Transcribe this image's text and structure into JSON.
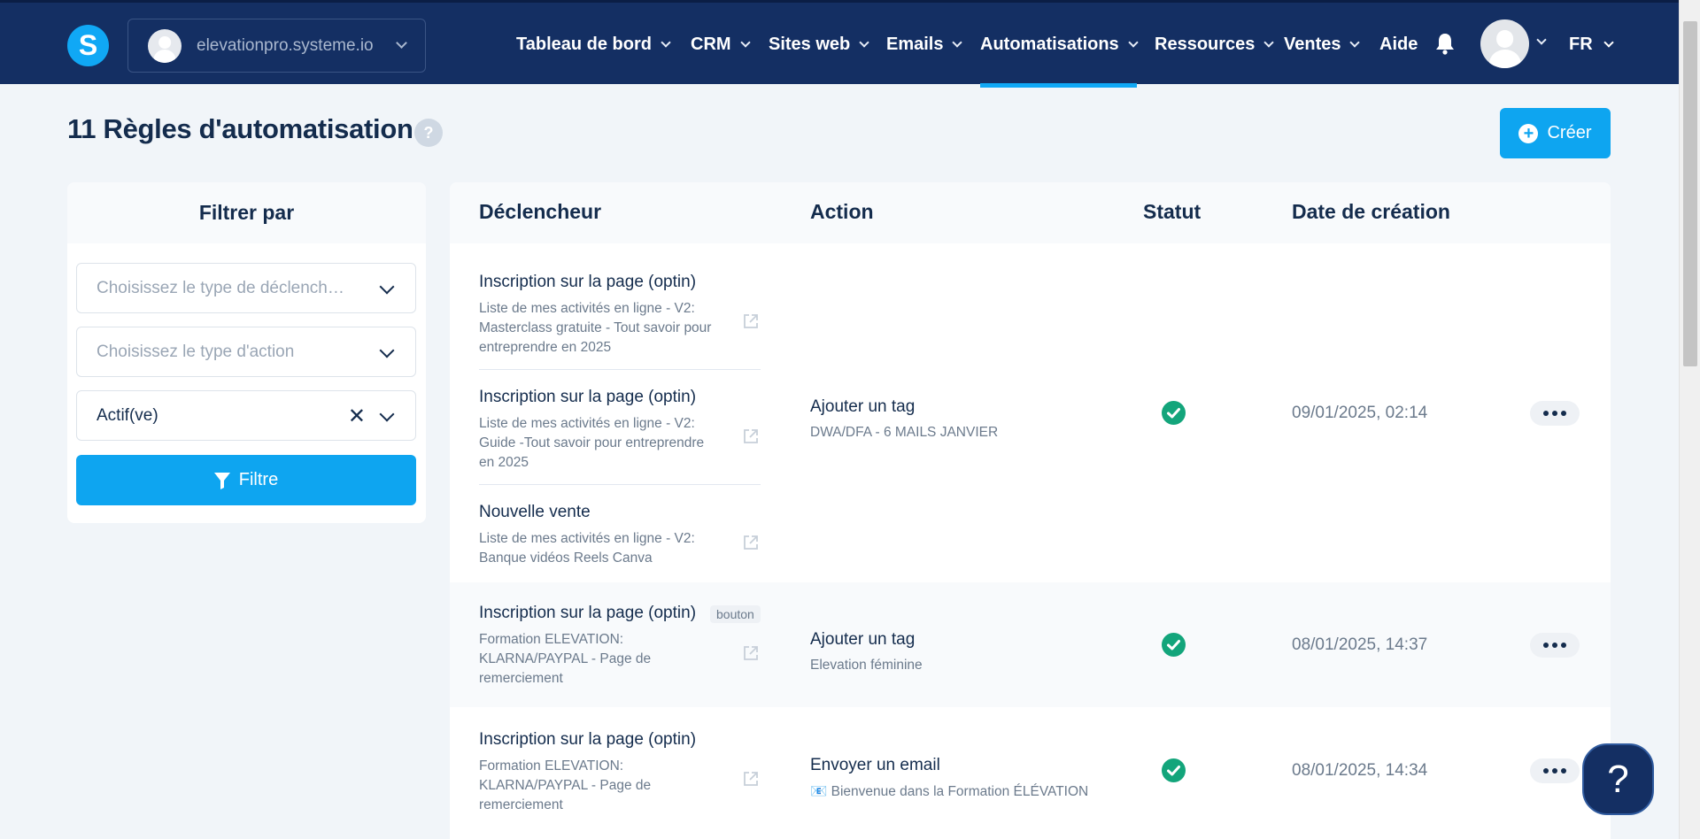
{
  "header": {
    "logo_letter": "S",
    "site": "elevationpro.systeme.io",
    "nav": [
      {
        "label": "Tableau de bord",
        "active": false
      },
      {
        "label": "CRM",
        "active": false
      },
      {
        "label": "Sites web",
        "active": false
      },
      {
        "label": "Emails",
        "active": false
      },
      {
        "label": "Automatisations",
        "active": true
      },
      {
        "label": "Ressources",
        "active": false
      },
      {
        "label": "Ventes",
        "active": false
      },
      {
        "label": "Aide",
        "active": false
      }
    ],
    "language": "FR"
  },
  "page": {
    "title": "11 Règles d'automatisation",
    "help": "?",
    "create_label": "Créer"
  },
  "filter": {
    "title": "Filtrer par",
    "trigger_placeholder": "Choisissez le type de déclench…",
    "action_placeholder": "Choisissez le type d'action",
    "status_value": "Actif(ve)",
    "button_label": "Filtre"
  },
  "table": {
    "columns": {
      "trigger": "Déclencheur",
      "action": "Action",
      "status": "Statut",
      "date": "Date de création"
    },
    "rows": [
      {
        "triggers": [
          {
            "title": "Inscription sur la page (optin)",
            "sub": "Liste de mes activités en ligne - V2: Masterclass gratuite - Tout savoir pour entreprendre en 2025"
          },
          {
            "title": "Inscription sur la page (optin)",
            "sub": "Liste de mes activités en ligne - V2: Guide -Tout savoir pour entreprendre en 2025"
          },
          {
            "title": "Nouvelle vente",
            "sub": "Liste de mes activités en ligne - V2: Banque vidéos Reels Canva"
          }
        ],
        "action_title": "Ajouter un tag",
        "action_sub": "DWA/DFA - 6 MAILS JANVIER",
        "date": "09/01/2025, 02:14"
      },
      {
        "triggers": [
          {
            "title": "Inscription sur la page (optin)",
            "badge": "bouton",
            "sub": "Formation ELEVATION: KLARNA/PAYPAL - Page de remerciement"
          }
        ],
        "action_title": "Ajouter un tag",
        "action_sub": "Elevation féminine",
        "date": "08/01/2025, 14:37"
      },
      {
        "triggers": [
          {
            "title": "Inscription sur la page (optin)",
            "sub": "Formation ELEVATION: KLARNA/PAYPAL - Page de remerciement"
          }
        ],
        "action_title": "Envoyer un email",
        "action_sub": "📧 Bienvenue dans la Formation ÉLÉVATION",
        "date": "08/01/2025, 14:34"
      }
    ]
  },
  "floating_help": "?",
  "colors": {
    "topbar": "#142f63",
    "accent": "#0ea5f0",
    "success": "#13a57b"
  }
}
